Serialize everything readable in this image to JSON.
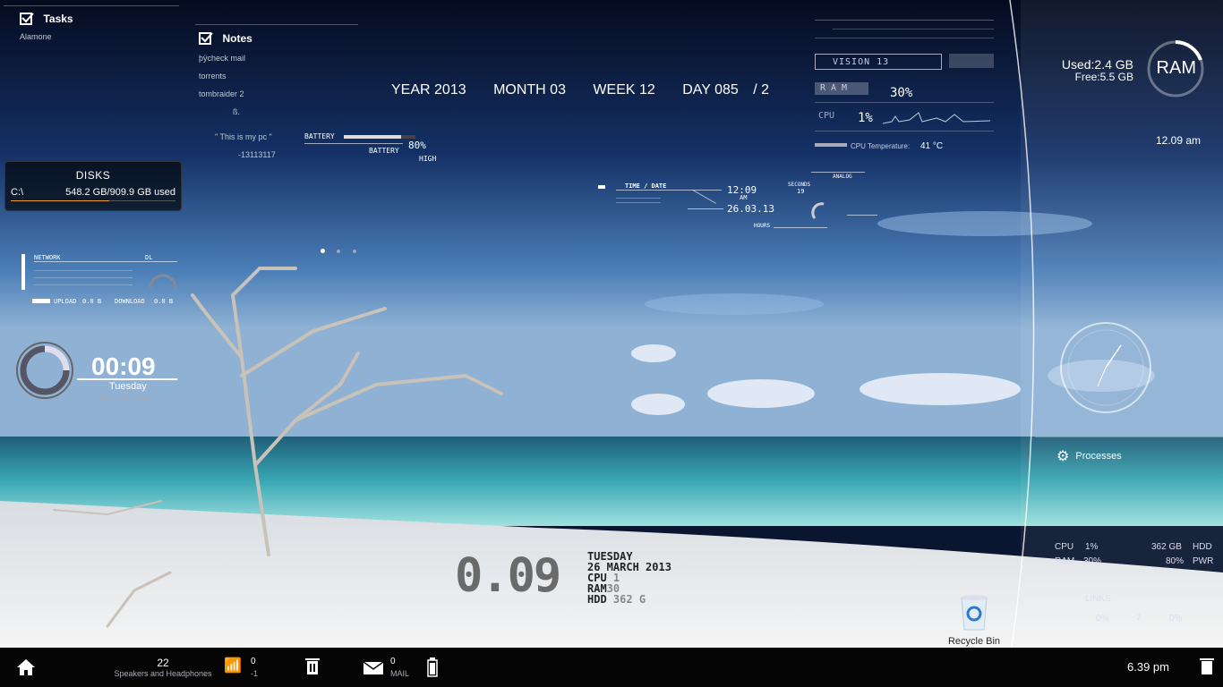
{
  "tasks": {
    "title": "Tasks",
    "items": [
      "Alamone"
    ]
  },
  "notes": {
    "title": "Notes",
    "items": [
      "þÿcheck mail",
      "torrents",
      "tombraider 2",
      "ß.",
      "\" This is my pc \"",
      "-13113117"
    ]
  },
  "disks": {
    "title": "DISKS",
    "drive": "C:\\",
    "usage": "548.2 GB/909.9 GB used",
    "fill_fraction": 0.6
  },
  "calendar": {
    "year": "YEAR 2013",
    "month": "MONTH 03",
    "week": "WEEK 12",
    "day": "DAY 085",
    "suffix": "/ 2"
  },
  "battery_widget": {
    "label1": "BATTERY",
    "pct": "80%",
    "label2": "BATTERY",
    "state": "HIGH",
    "level": 0.8
  },
  "network": {
    "title": "NETWORK",
    "dl": "DL",
    "upload_label": "UPLOAD",
    "upload_val": "0.0 B",
    "download_label": "DOWNLOAD",
    "download_val": "0.0 B"
  },
  "clock": {
    "time": "00:09",
    "day": "Tuesday",
    "date": "March 26, 2013"
  },
  "timedate": {
    "title": "TIME / DATE",
    "time": "12:09",
    "ampm": "AM",
    "date": "26.03.13",
    "seconds_label": "SECONDS",
    "seconds": "19",
    "hours": "HOURS",
    "analog": "ANALOG"
  },
  "vision": {
    "title": "VISION 13",
    "ram_label": "RAM",
    "ram_pct": "30%",
    "cpu_label": "CPU",
    "cpu_pct": "1%",
    "temp_label": "CPU Temperature:",
    "temp": "41 °C"
  },
  "ram": {
    "used": "Used:2.4 GB",
    "free": "Free:5.5 GB",
    "label": "RAM",
    "used_fraction": 0.3
  },
  "right_clock": "12.09 am",
  "processes": "Processes",
  "stats": {
    "cpu_label": "CPU",
    "cpu": "1%",
    "ram_label": "RAM",
    "ram": "30%",
    "hdd": "362 GB",
    "hdd_label": "HDD",
    "pwr": "80%",
    "pwr_label": "PWR",
    "links": "LINKS",
    "net1": "0%",
    "net_mid": "2",
    "net2": "0%"
  },
  "bigclock": {
    "time": "0.09",
    "day": "TUESDAY",
    "date": "26 MARCH 2013",
    "cpu_label": "CPU",
    "cpu": "1",
    "ram_label": "RAM",
    "ram": "30",
    "hdd_label": "HDD",
    "hdd": "362 G"
  },
  "recycle_bin": "Recycle Bin",
  "taskbar": {
    "volume": "22",
    "audio_device": "Speakers and Headphones",
    "wifi_val": "0",
    "wifi_sub": "-1",
    "mail_count": "0",
    "mail_label": "MAIL",
    "time": "6.39 pm"
  },
  "colors": {
    "accent": "#f0a020",
    "sky_top": "#0a1630",
    "sea": "#4fc3c9",
    "sand": "#e8e8e8"
  }
}
